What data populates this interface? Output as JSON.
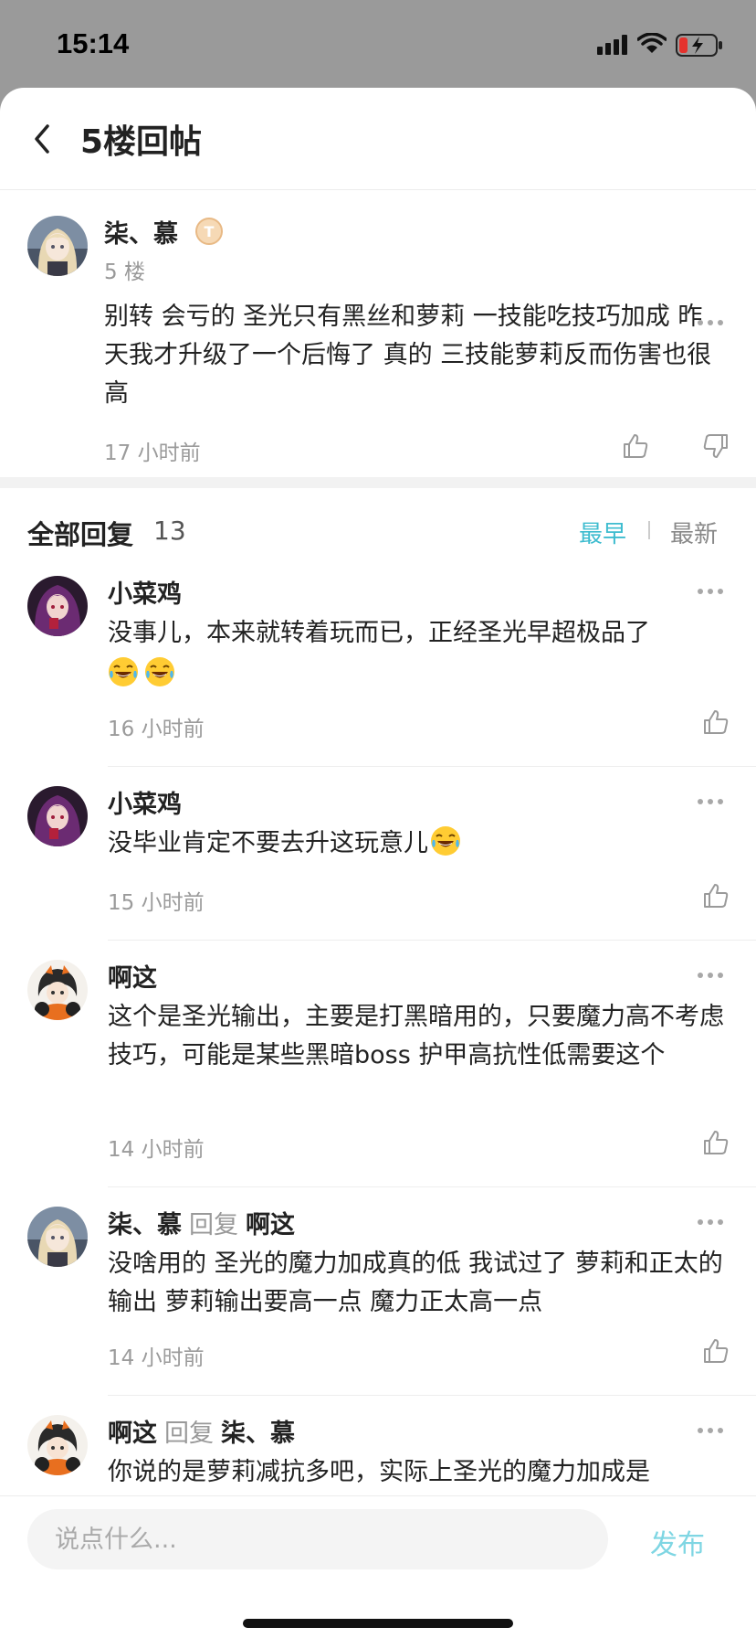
{
  "status_bar": {
    "time": "15:14"
  },
  "header": {
    "title": "5楼回帖"
  },
  "main_post": {
    "username": "柒、慕",
    "floor": "5 楼",
    "content": "别转 会亏的  圣光只有黑丝和萝莉 一技能吃技巧加成 昨天我才升级了一个后悔了 真的 三技能萝莉反而伤害也很高",
    "time": "17 小时前",
    "badge_letter": "T"
  },
  "replies_header": {
    "title": "全部回复",
    "count": "13",
    "sort_earliest": "最早",
    "sort_latest": "最新"
  },
  "replies": [
    {
      "username": "小菜鸡",
      "reply_word": "",
      "reply_to": "",
      "content": "没事儿，本来就转着玩而已，正经圣光早超极品了",
      "time": "16 小时前"
    },
    {
      "username": "小菜鸡",
      "reply_word": "",
      "reply_to": "",
      "content": "没毕业肯定不要去升这玩意儿",
      "time": "15 小时前"
    },
    {
      "username": "啊这",
      "reply_word": "",
      "reply_to": "",
      "content": "这个是圣光输出，主要是打黑暗用的，只要魔力高不考虑技巧，可能是某些黑暗boss 护甲高抗性低需要这个",
      "time": "14 小时前"
    },
    {
      "username": "柒、慕",
      "reply_word": "回复",
      "reply_to": "啊这",
      "content": "没啥用的 圣光的魔力加成真的低 我试过了 萝莉和正太的输出 萝莉输出要高一点 魔力正太高一点",
      "time": "14 小时前"
    },
    {
      "username": "啊这",
      "reply_word": "回复",
      "reply_to": "柒、慕",
      "content": "你说的是萝莉减抗多吧，实际上圣光的魔力加成是",
      "time": ""
    }
  ],
  "comment_box": {
    "placeholder": "说点什么...",
    "publish_label": "发布"
  },
  "colors": {
    "accent": "#3ebccf",
    "publish": "#7fd6e3",
    "muted": "#999999"
  }
}
